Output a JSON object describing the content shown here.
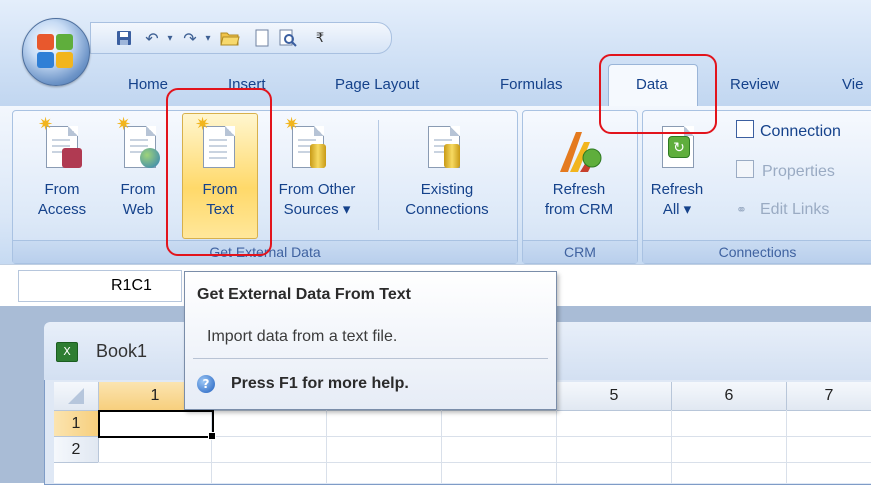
{
  "qat": {
    "icons": [
      "save-icon",
      "undo-icon",
      "undo-dropdown-icon",
      "redo-icon",
      "redo-dropdown-icon",
      "open-folder-icon",
      "new-document-icon",
      "print-preview-icon",
      "customize-qat-icon"
    ]
  },
  "tabs": [
    {
      "label": "Home"
    },
    {
      "label": "Insert"
    },
    {
      "label": "Page Layout"
    },
    {
      "label": "Formulas"
    },
    {
      "label": "Data"
    },
    {
      "label": "Review"
    },
    {
      "label": "Vie"
    }
  ],
  "active_tab": "Data",
  "ribbon": {
    "get_external_data": {
      "title": "Get External Data",
      "from_access": {
        "line1": "From",
        "line2": "Access"
      },
      "from_web": {
        "line1": "From",
        "line2": "Web"
      },
      "from_text": {
        "line1": "From",
        "line2": "Text"
      },
      "from_other": {
        "line1": "From Other",
        "line2": "Sources ▾"
      },
      "existing": {
        "line1": "Existing",
        "line2": "Connections"
      }
    },
    "crm": {
      "title": "CRM",
      "refresh_crm": {
        "line1": "Refresh",
        "line2": "from CRM"
      }
    },
    "connections": {
      "title": "Connections",
      "refresh_all": {
        "line1": "Refresh",
        "line2": "All ▾"
      },
      "connections_label": "Connection",
      "properties_label": "Properties",
      "edit_links_label": "Edit Links"
    }
  },
  "name_box": {
    "value": "R1C1"
  },
  "tooltip": {
    "title": "Get External Data From Text",
    "body": "Import data from a text file.",
    "help": "Press F1 for more help."
  },
  "workbook": {
    "title": "Book1",
    "columns": [
      "1",
      "",
      "",
      "",
      "5",
      "6",
      "7"
    ],
    "rows": [
      "1",
      "2"
    ]
  },
  "colors": {
    "accent_text": "#15428b",
    "annotation_red": "#e2141c",
    "ribbon_bg": "#dae7f7"
  }
}
